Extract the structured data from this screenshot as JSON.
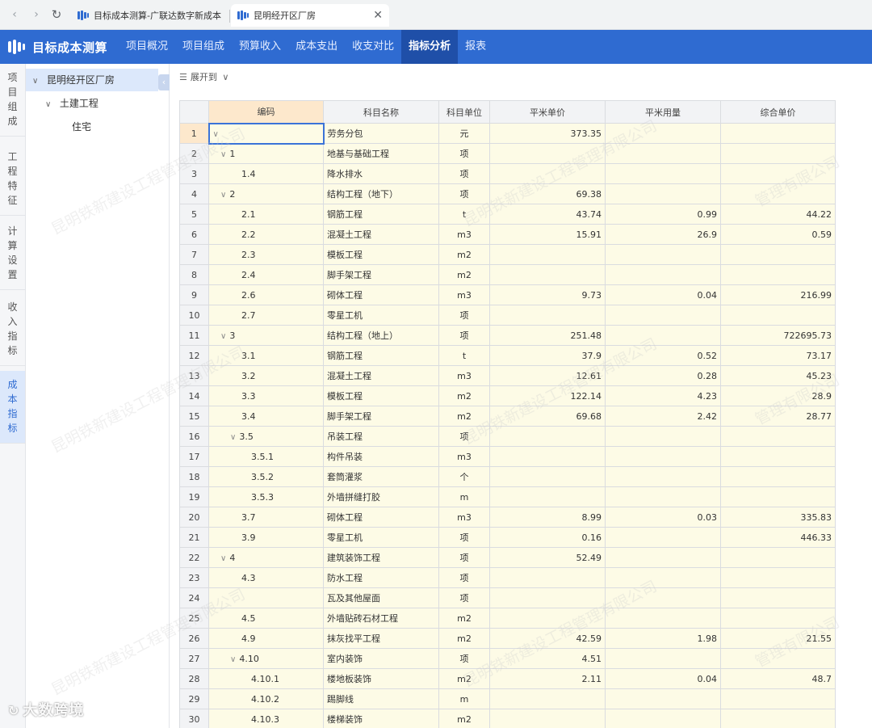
{
  "browser": {
    "tabs": [
      {
        "title": "目标成本测算-广联达数字新成本"
      },
      {
        "title": "昆明经开区厂房"
      }
    ]
  },
  "app": {
    "title": "目标成本测算",
    "menu": [
      "项目概况",
      "项目组成",
      "预算收入",
      "成本支出",
      "收支对比",
      "指标分析",
      "报表"
    ],
    "active_menu": "指标分析"
  },
  "side_tabs": [
    "项目组成",
    "工程特征",
    "计算设置",
    "收入指标",
    "成本指标"
  ],
  "tree": {
    "root": "昆明经开区厂房",
    "child": "土建工程",
    "leaf": "住宅"
  },
  "toolbar": {
    "expand_label": "展开到"
  },
  "grid": {
    "headers": [
      "编码",
      "科目名称",
      "科目单位",
      "平米单价",
      "平米用量",
      "综合单价"
    ],
    "rows": [
      {
        "n": "1",
        "code": "",
        "name": "劳务分包",
        "unit": "元",
        "price": "373.35",
        "qty": "",
        "unit_price": ""
      },
      {
        "n": "2",
        "code": "1",
        "name": "地基与基础工程",
        "unit": "项",
        "price": "",
        "qty": "",
        "unit_price": ""
      },
      {
        "n": "3",
        "code": "1.4",
        "name": "降水排水",
        "unit": "项",
        "price": "",
        "qty": "",
        "unit_price": ""
      },
      {
        "n": "4",
        "code": "2",
        "name": "结构工程（地下）",
        "unit": "项",
        "price": "69.38",
        "qty": "",
        "unit_price": ""
      },
      {
        "n": "5",
        "code": "2.1",
        "name": "钢筋工程",
        "unit": "t",
        "price": "43.74",
        "qty": "0.99",
        "unit_price": "44.22"
      },
      {
        "n": "6",
        "code": "2.2",
        "name": "混凝土工程",
        "unit": "m3",
        "price": "15.91",
        "qty": "26.9",
        "unit_price": "0.59"
      },
      {
        "n": "7",
        "code": "2.3",
        "name": "模板工程",
        "unit": "m2",
        "price": "",
        "qty": "",
        "unit_price": ""
      },
      {
        "n": "8",
        "code": "2.4",
        "name": "脚手架工程",
        "unit": "m2",
        "price": "",
        "qty": "",
        "unit_price": ""
      },
      {
        "n": "9",
        "code": "2.6",
        "name": "砌体工程",
        "unit": "m3",
        "price": "9.73",
        "qty": "0.04",
        "unit_price": "216.99"
      },
      {
        "n": "10",
        "code": "2.7",
        "name": "零星工机",
        "unit": "项",
        "price": "",
        "qty": "",
        "unit_price": ""
      },
      {
        "n": "11",
        "code": "3",
        "name": "结构工程（地上）",
        "unit": "项",
        "price": "251.48",
        "qty": "",
        "unit_price": "722695.73"
      },
      {
        "n": "12",
        "code": "3.1",
        "name": "钢筋工程",
        "unit": "t",
        "price": "37.9",
        "qty": "0.52",
        "unit_price": "73.17"
      },
      {
        "n": "13",
        "code": "3.2",
        "name": "混凝土工程",
        "unit": "m3",
        "price": "12.61",
        "qty": "0.28",
        "unit_price": "45.23"
      },
      {
        "n": "14",
        "code": "3.3",
        "name": "模板工程",
        "unit": "m2",
        "price": "122.14",
        "qty": "4.23",
        "unit_price": "28.9"
      },
      {
        "n": "15",
        "code": "3.4",
        "name": "脚手架工程",
        "unit": "m2",
        "price": "69.68",
        "qty": "2.42",
        "unit_price": "28.77"
      },
      {
        "n": "16",
        "code": "3.5",
        "name": "吊装工程",
        "unit": "项",
        "price": "",
        "qty": "",
        "unit_price": ""
      },
      {
        "n": "17",
        "code": "3.5.1",
        "name": "构件吊装",
        "unit": "m3",
        "price": "",
        "qty": "",
        "unit_price": ""
      },
      {
        "n": "18",
        "code": "3.5.2",
        "name": "套筒灌浆",
        "unit": "个",
        "price": "",
        "qty": "",
        "unit_price": ""
      },
      {
        "n": "19",
        "code": "3.5.3",
        "name": "外墙拼缝打胶",
        "unit": "m",
        "price": "",
        "qty": "",
        "unit_price": ""
      },
      {
        "n": "20",
        "code": "3.7",
        "name": "砌体工程",
        "unit": "m3",
        "price": "8.99",
        "qty": "0.03",
        "unit_price": "335.83"
      },
      {
        "n": "21",
        "code": "3.9",
        "name": "零星工机",
        "unit": "项",
        "price": "0.16",
        "qty": "",
        "unit_price": "446.33"
      },
      {
        "n": "22",
        "code": "4",
        "name": "建筑装饰工程",
        "unit": "项",
        "price": "52.49",
        "qty": "",
        "unit_price": ""
      },
      {
        "n": "23",
        "code": "4.3",
        "name": "防水工程",
        "unit": "项",
        "price": "",
        "qty": "",
        "unit_price": ""
      },
      {
        "n": "24",
        "code": "",
        "name": "瓦及其他屋面",
        "unit": "项",
        "price": "",
        "qty": "",
        "unit_price": ""
      },
      {
        "n": "25",
        "code": "4.5",
        "name": "外墙贴砖石材工程",
        "unit": "m2",
        "price": "",
        "qty": "",
        "unit_price": ""
      },
      {
        "n": "26",
        "code": "4.9",
        "name": "抹灰找平工程",
        "unit": "m2",
        "price": "42.59",
        "qty": "1.98",
        "unit_price": "21.55"
      },
      {
        "n": "27",
        "code": "4.10",
        "name": "室内装饰",
        "unit": "项",
        "price": "4.51",
        "qty": "",
        "unit_price": ""
      },
      {
        "n": "28",
        "code": "4.10.1",
        "name": "楼地板装饰",
        "unit": "m2",
        "price": "2.11",
        "qty": "0.04",
        "unit_price": "48.7"
      },
      {
        "n": "29",
        "code": "4.10.2",
        "name": "踢脚线",
        "unit": "m",
        "price": "",
        "qty": "",
        "unit_price": ""
      },
      {
        "n": "30",
        "code": "4.10.3",
        "name": "楼梯装饰",
        "unit": "m2",
        "price": "",
        "qty": "",
        "unit_price": ""
      }
    ]
  },
  "watermark": {
    "a": "昆明铁新建设工程管理有限公司",
    "b": "管理有限公司"
  },
  "brand": "大数跨境",
  "colors": {
    "primary": "#2f6bd1",
    "menu_active": "#1f4fa8",
    "cell_fill": "#fdfbe6",
    "header_highlight": "#fde8cc"
  }
}
